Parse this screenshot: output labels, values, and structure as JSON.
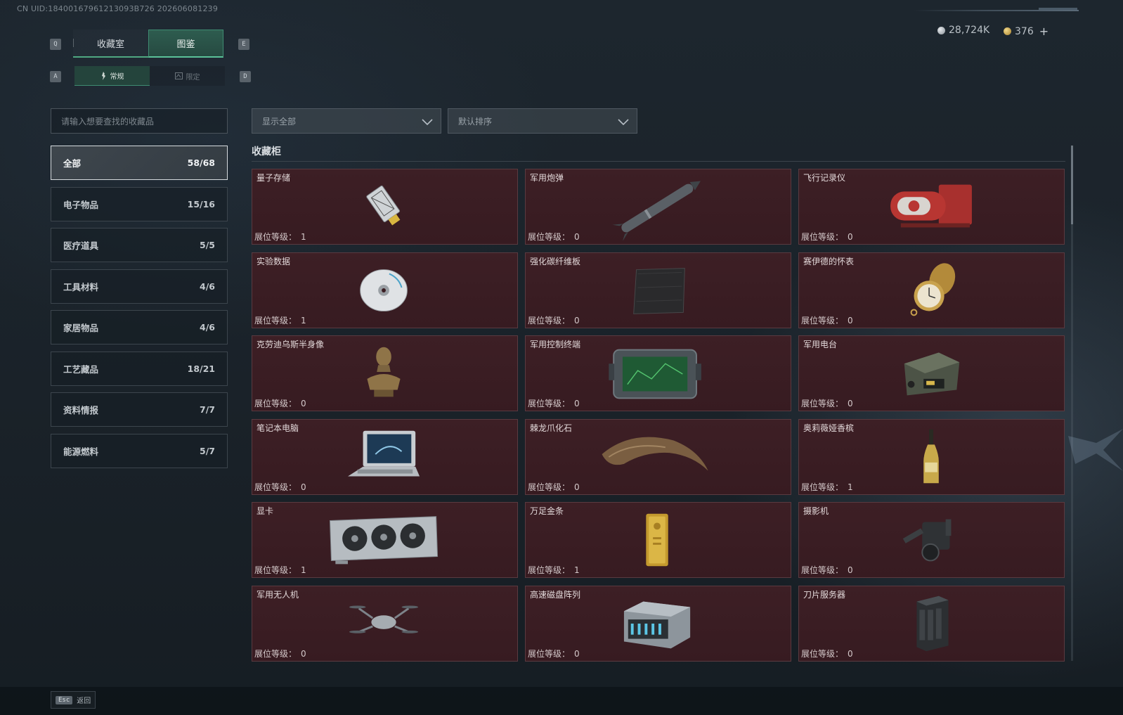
{
  "uid_text": "CN UID:18400167961213093B726 202606081239",
  "currency": {
    "silver": "28,724K",
    "gold": "376",
    "plus": "+"
  },
  "keys": {
    "prev_tab": "Q",
    "next_tab": "E",
    "prev_sub": "A",
    "next_sub": "D"
  },
  "main_tabs": [
    {
      "label": "收藏室"
    },
    {
      "label": "图鉴"
    }
  ],
  "sub_tabs": [
    {
      "label": "常规"
    },
    {
      "label": "限定"
    }
  ],
  "search": {
    "placeholder": "请输入想要查找的收藏品"
  },
  "filter_dropdown": {
    "value": "显示全部"
  },
  "sort_dropdown": {
    "value": "默认排序"
  },
  "categories": [
    {
      "label": "全部",
      "count": "58/68"
    },
    {
      "label": "电子物品",
      "count": "15/16"
    },
    {
      "label": "医疗道具",
      "count": "5/5"
    },
    {
      "label": "工具材料",
      "count": "4/6"
    },
    {
      "label": "家居物品",
      "count": "4/6"
    },
    {
      "label": "工艺藏品",
      "count": "18/21"
    },
    {
      "label": "资料情报",
      "count": "7/7"
    },
    {
      "label": "能源燃料",
      "count": "5/7"
    }
  ],
  "section_title": "收藏柜",
  "level_label": "展位等级：",
  "items": [
    {
      "name": "量子存储",
      "level": "1",
      "icon": "usb-drive-icon"
    },
    {
      "name": "军用炮弹",
      "level": "0",
      "icon": "missile-icon"
    },
    {
      "name": "飞行记录仪",
      "level": "0",
      "icon": "flight-recorder-icon"
    },
    {
      "name": "实验数据",
      "level": "1",
      "icon": "disc-icon"
    },
    {
      "name": "强化碳纤维板",
      "level": "0",
      "icon": "carbon-plate-icon"
    },
    {
      "name": "赛伊德的怀表",
      "level": "0",
      "icon": "pocket-watch-icon"
    },
    {
      "name": "克劳迪乌斯半身像",
      "level": "0",
      "icon": "bust-icon"
    },
    {
      "name": "军用控制终端",
      "level": "0",
      "icon": "control-terminal-icon"
    },
    {
      "name": "军用电台",
      "level": "0",
      "icon": "radio-icon"
    },
    {
      "name": "笔记本电脑",
      "level": "0",
      "icon": "laptop-icon"
    },
    {
      "name": "棘龙爪化石",
      "level": "0",
      "icon": "claw-fossil-icon"
    },
    {
      "name": "奥莉薇娅香槟",
      "level": "1",
      "icon": "champagne-icon"
    },
    {
      "name": "显卡",
      "level": "1",
      "icon": "graphics-card-icon"
    },
    {
      "name": "万足金条",
      "level": "1",
      "icon": "gold-bar-icon"
    },
    {
      "name": "摄影机",
      "level": "0",
      "icon": "camera-icon"
    },
    {
      "name": "军用无人机",
      "level": "0",
      "icon": "drone-icon"
    },
    {
      "name": "高速磁盘阵列",
      "level": "0",
      "icon": "disk-array-icon"
    },
    {
      "name": "刀片服务器",
      "level": "0",
      "icon": "blade-server-icon"
    }
  ],
  "footer": {
    "esc_key": "Esc",
    "back_label": "返回"
  }
}
